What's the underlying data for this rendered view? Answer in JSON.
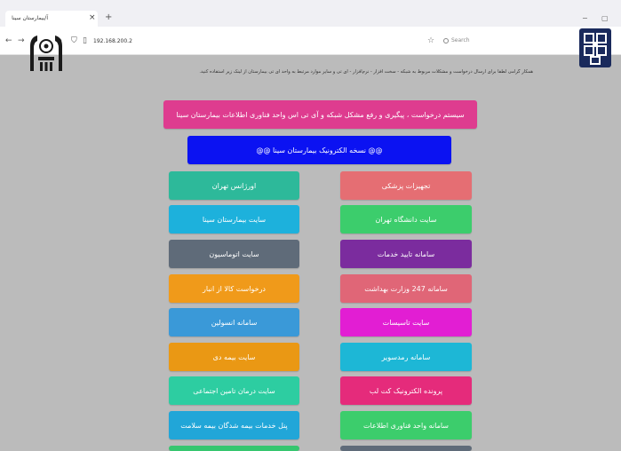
{
  "browser": {
    "tab_title": "آ/بیمارستان سینا",
    "tab_close": "×",
    "new_tab": "+",
    "address": "192.168.200.2",
    "search_placeholder": "Search",
    "minimize": "−",
    "maximize": "▢"
  },
  "page": {
    "notice": "همکار گرامی لطفا برای ارسال درخواست و مشکلات مربوط به شبکه - سخت افزار - نرم‌افزار - آی تی و سایر موارد مرتبط به واحد آی تی بیمارستان از لینک زیر استفاده کنید.",
    "header_button": "سیستم درخواست ، پیگیری و رفع مشکل شبکه و آی تی اس واحد فناوری اطلاعات بیمارستان سینا",
    "sub_header_button": "@@ نسخه الکترونیک بیمارستان سینا @@",
    "buttons_right": [
      {
        "label": "تجهیزات پزشکی",
        "color": "#e56e73"
      },
      {
        "label": "سایت دانشگاه تهران",
        "color": "#3ccd6c"
      },
      {
        "label": "سامانه تایید خدمات",
        "color": "#7b2c9e"
      },
      {
        "label": "سامانه 247 وزارت بهداشت",
        "color": "#e06677"
      },
      {
        "label": "سایت تاسیسات",
        "color": "#e21ed3"
      },
      {
        "label": "سامانه رمدسویر",
        "color": "#1db7d6"
      },
      {
        "label": "پرونده الکترونیک کت لب",
        "color": "#e52b7b"
      },
      {
        "label": "سامانه واحد فناوری اطلاعات",
        "color": "#3ccd6c"
      }
    ],
    "buttons_left": [
      {
        "label": "اورژانس تهران",
        "color": "#2db99a"
      },
      {
        "label": "سایت بیمارستان سینا",
        "color": "#1db1dc"
      },
      {
        "label": "سایت اتوماسیون",
        "color": "#5f6b79"
      },
      {
        "label": "درخواست کالا از انبار",
        "color": "#f09a1a"
      },
      {
        "label": "سامانه انسولین",
        "color": "#3a99d8"
      },
      {
        "label": "سایت بیمه دی",
        "color": "#ea9814"
      },
      {
        "label": "سایت درمان تامین اجتماعی",
        "color": "#2dcda1"
      },
      {
        "label": "پنل خدمات بیمه شدگان بیمه سلامت",
        "color": "#21a6d8"
      }
    ],
    "row_partial_left_color": "#36c66f",
    "row_partial_right_color": "#5f6b79",
    "header_color": "#de3c8f",
    "sub_header_color": "#0b12f2"
  }
}
